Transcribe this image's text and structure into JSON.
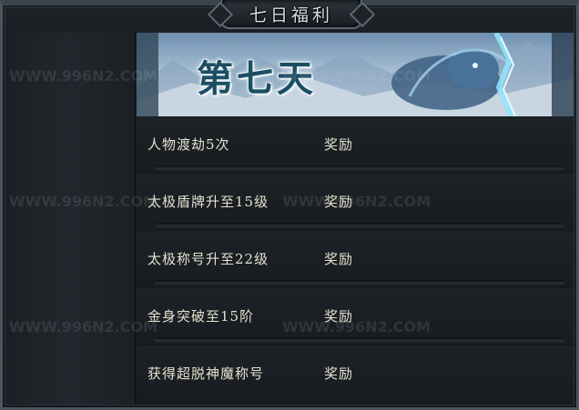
{
  "window": {
    "title": "七日福利"
  },
  "banner": {
    "day_title": "第七天"
  },
  "tasks": [
    {
      "name": "人物渡劫5次",
      "reward": "奖励"
    },
    {
      "name": "太极盾牌升至15级",
      "reward": "奖励"
    },
    {
      "name": "太极称号升至22级",
      "reward": "奖励"
    },
    {
      "name": "金身突破至15阶",
      "reward": "奖励"
    },
    {
      "name": "获得超脱神魔称号",
      "reward": "奖励"
    }
  ],
  "watermark": {
    "text": "WWW.996N2.COM"
  },
  "icons": [
    "dragon-illustration"
  ],
  "colors": {
    "accent_text": "#e4e1cf",
    "banner_title": "#1c4e63",
    "frame": "#4a5560"
  }
}
